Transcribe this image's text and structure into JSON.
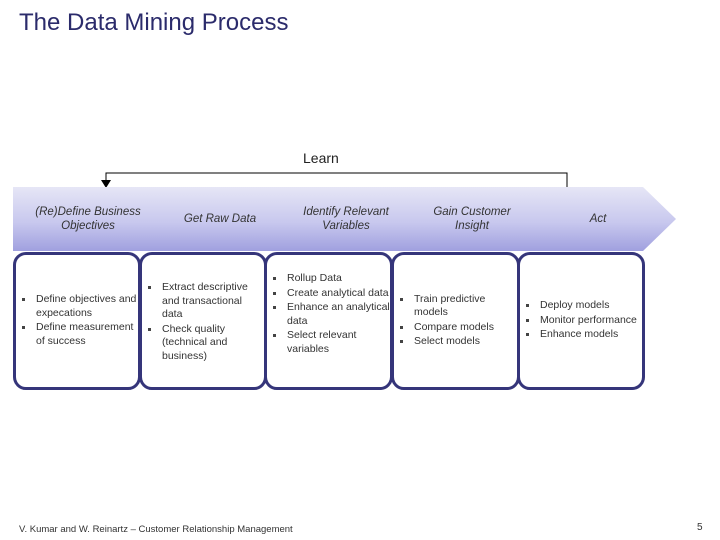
{
  "title": "The Data Mining Process",
  "loop_label": "Learn",
  "stages": [
    {
      "label": "(Re)Define Business Objectives",
      "bullets": [
        "Define objectives and expecations",
        "Define measurement of success"
      ]
    },
    {
      "label": "Get Raw Data",
      "bullets": [
        "Extract descriptive and transactional data",
        "Check quality (technical and business)"
      ]
    },
    {
      "label": "Identify Relevant Variables",
      "bullets": [
        "Rollup Data",
        "Create analytical data",
        "Enhance an analytical data",
        "Select relevant variables"
      ]
    },
    {
      "label": "Gain Customer Insight",
      "bullets": [
        "Train predictive models",
        "Compare models",
        "Select models"
      ]
    },
    {
      "label": "Act",
      "bullets": [
        "Deploy models",
        "Monitor performance",
        "Enhance models"
      ]
    }
  ],
  "colors": {
    "title": "#2b2b6b",
    "box_border": "#35357a",
    "banner_top": "#e3e3f5",
    "banner_bottom": "#a3a3e0"
  },
  "footer": "V. Kumar and W. Reinartz – Customer Relationship Management",
  "page_number": "5"
}
